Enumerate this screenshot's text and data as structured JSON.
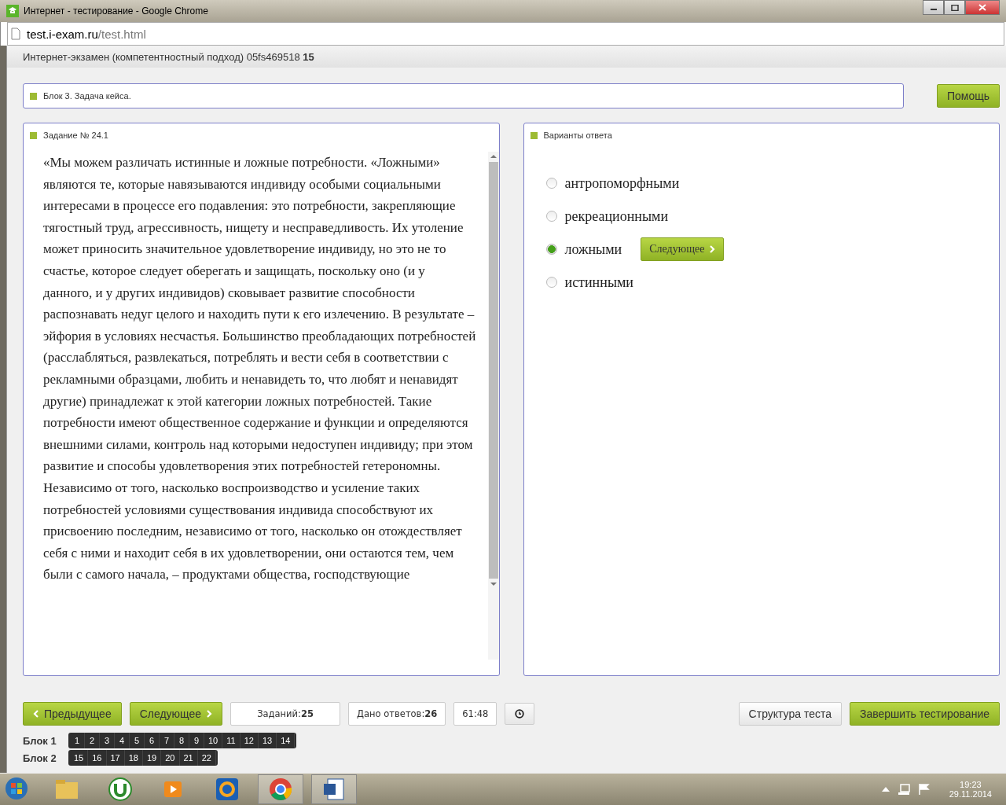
{
  "window": {
    "title": "Интернет - тестирование - Google Chrome"
  },
  "address": {
    "domain": "test.i-exam.ru",
    "path": "/test.html"
  },
  "header": {
    "text": "Интернет-экзамен (компетентностный подход) 05fs469518",
    "number": "15"
  },
  "block_title": "Блок 3. Задача кейса.",
  "help_button": "Помощь",
  "task_panel": {
    "title": "Задание № 24.1",
    "text": "«Мы можем различать истинные и ложные потребности. «Ложными» являются те, которые навязываются индивиду особыми социальными интересами в процессе его подавления: это потребности, закрепляющие тягостный труд, агрессивность, нищету и несправедливость. Их утоление может приносить значительное удовлетворение индивиду, но это не то счастье, которое следует оберегать и защищать, поскольку оно (и у данного, и у других индивидов) сковывает развитие способности распознавать недуг целого и находить пути к его излечению. В результате – эйфория в условиях несчастья. Большинство преобладающих потребностей (расслабляться, развлекаться, потреблять и вести себя в соответствии с рекламными образцами, любить и ненавидеть то, что любят и ненавидят другие) принадлежат к этой категории ложных потребностей. Такие потребности имеют общественное содержание и функции и определяются внешними силами, контроль над которыми недоступен индивиду; при этом развитие и способы удовлетворения этих потребностей гетерономны. Независимо от того, насколько воспроизводство и усиление таких потребностей условиями существования индивида способствуют их присвоению последним, независимо от того, насколько он отождествляет себя с ними и находит себя в их удовлетворении, они остаются тем, чем были с самого начала, – продуктами общества, господствующие"
  },
  "answers_panel": {
    "title": "Варианты ответа",
    "next_button": "Следующее",
    "options": [
      {
        "label": "антропоморфными",
        "selected": false
      },
      {
        "label": "рекреационными",
        "selected": false
      },
      {
        "label": "ложными",
        "selected": true
      },
      {
        "label": "истинными",
        "selected": false
      }
    ]
  },
  "footer": {
    "prev": "Предыдущее",
    "next": "Следующее",
    "tasks_label": "Заданий:",
    "tasks_count": "25",
    "answered_label": "Дано ответов:",
    "answered_count": "26",
    "timer": "61:48",
    "structure": "Структура теста",
    "finish": "Завершить тестирование"
  },
  "blocks": [
    {
      "label": "Блок 1",
      "numbers": [
        "1",
        "2",
        "3",
        "4",
        "5",
        "6",
        "7",
        "8",
        "9",
        "10",
        "11",
        "12",
        "13",
        "14"
      ]
    },
    {
      "label": "Блок 2",
      "numbers": [
        "15",
        "16",
        "17",
        "18",
        "19",
        "20",
        "21",
        "22"
      ]
    }
  ],
  "taskbar": {
    "time": "19:23",
    "date": "29.11.2014"
  }
}
